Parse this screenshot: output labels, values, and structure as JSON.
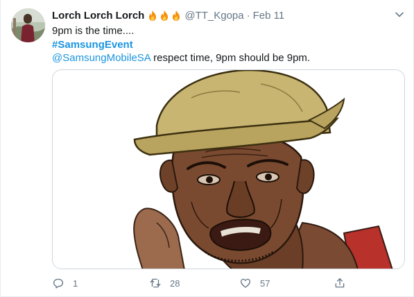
{
  "tweet": {
    "display_name": "Lorch Lorch Lorch",
    "handle": "@TT_Kgopa",
    "separator": "·",
    "date": "Feb 11",
    "text_line1": "9pm is the time....",
    "hashtag": "#SamsungEvent",
    "mention": "@SamsungMobileSA",
    "text_line3_rest": " respect time, 9pm should be 9pm.",
    "emoji_names": [
      "fire-icon",
      "fire-icon",
      "fire-icon"
    ]
  },
  "actions": {
    "reply_count": "1",
    "retweet_count": "28",
    "like_count": "57"
  },
  "colors": {
    "link": "#1b95e0",
    "secondary_text": "#657786",
    "border": "#e6ecf0"
  }
}
